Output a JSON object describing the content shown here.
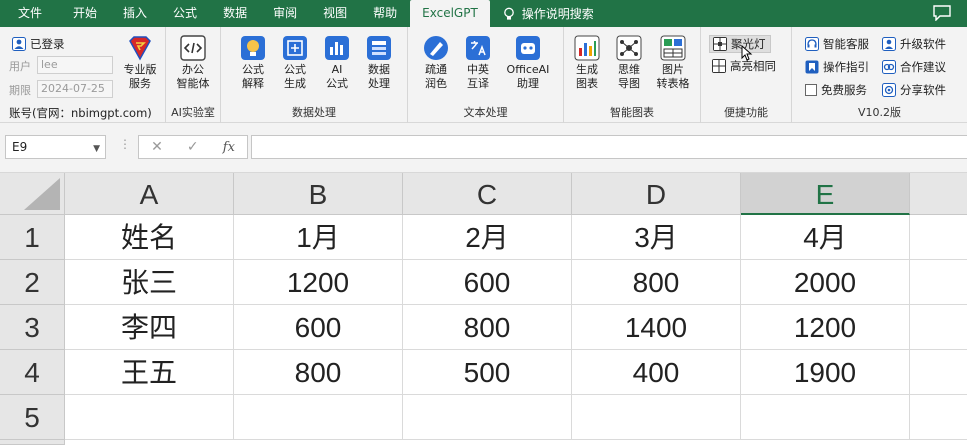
{
  "menubar": {
    "tabs": [
      "文件",
      "开始",
      "插入",
      "公式",
      "数据",
      "审阅",
      "视图",
      "帮助",
      "ExcelGPT"
    ],
    "active_tab": "ExcelGPT",
    "search_label": "操作说明搜索"
  },
  "ribbon": {
    "account": {
      "login_status": "已登录",
      "user_label": "用户",
      "user_value": "lee",
      "expiry_label": "期限",
      "expiry_value": "2024-07-25",
      "account_line": "账号(官网：nbimgpt.com)",
      "pro_service_label": "专业版\n服务"
    },
    "ai_lab": {
      "button_label": "办公\n智能体",
      "group_label": "AI实验室"
    },
    "data_processing": {
      "buttons": [
        "公式\n解释",
        "公式\n生成",
        "AI\n公式",
        "数据\n处理"
      ],
      "group_label": "数据处理"
    },
    "text_processing": {
      "buttons": [
        "疏通\n润色",
        "中英\n互译",
        "OfficeAI\n助理"
      ],
      "group_label": "文本处理"
    },
    "smart_chart": {
      "buttons": [
        "生成\n图表",
        "思维\n导图",
        "图片\n转表格"
      ],
      "group_label": "智能图表"
    },
    "quick": {
      "spotlight_label": "聚光灯",
      "highlight_label": "高亮相同",
      "group_label": "便捷功能"
    },
    "version": {
      "items": [
        "智能客服",
        "升级软件",
        "操作指引",
        "合作建议",
        "免费服务",
        "分享软件"
      ],
      "group_label": "V10.2版"
    }
  },
  "formula_bar": {
    "name_box": "E9",
    "fx_label": "fx",
    "formula": ""
  },
  "sheet": {
    "columns": [
      "A",
      "B",
      "C",
      "D",
      "E"
    ],
    "selected_column": "E",
    "rows": [
      "1",
      "2",
      "3",
      "4",
      "5"
    ],
    "cells": [
      [
        "姓名",
        "1月",
        "2月",
        "3月",
        "4月"
      ],
      [
        "张三",
        "1200",
        "600",
        "800",
        "2000"
      ],
      [
        "李四",
        "600",
        "800",
        "1400",
        "1200"
      ],
      [
        "王五",
        "800",
        "500",
        "400",
        "1900"
      ],
      [
        "",
        "",
        "",
        "",
        ""
      ]
    ]
  },
  "colors": {
    "brand_green": "#217346",
    "ribbon_bg": "#f3f3f3"
  }
}
